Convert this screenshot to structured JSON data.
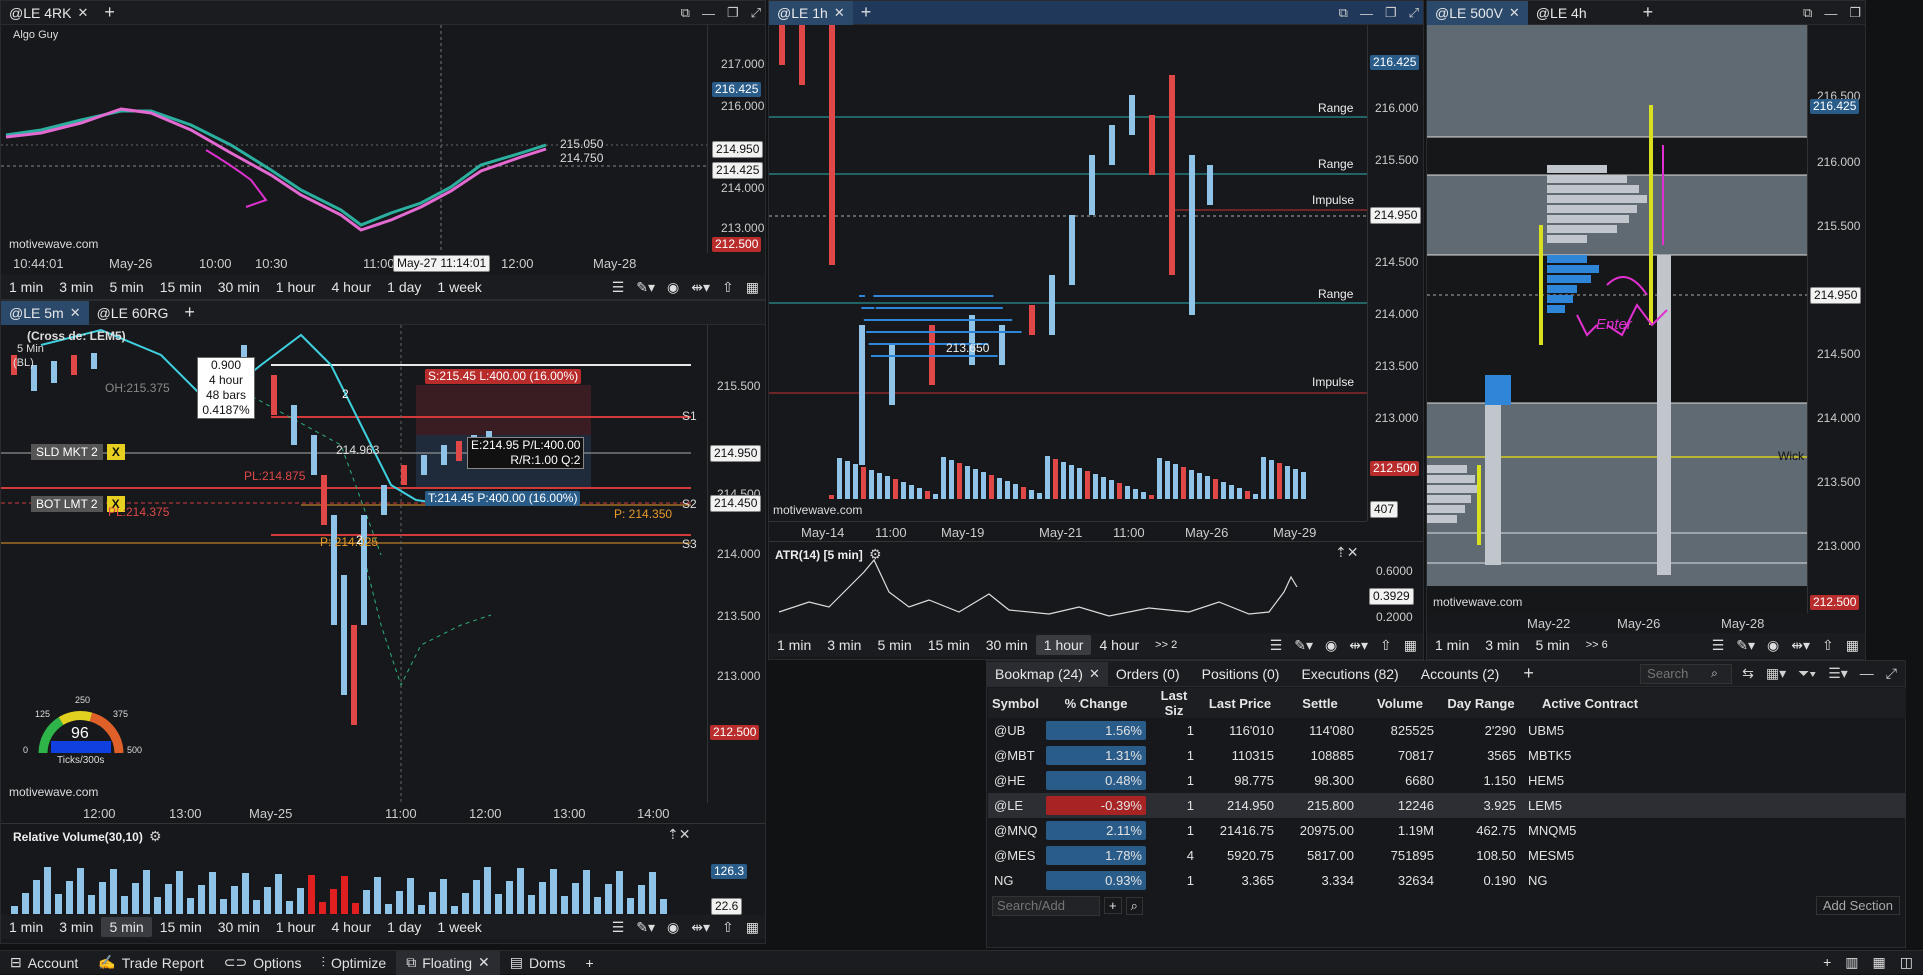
{
  "panel1": {
    "tabs": [
      "@LE 4RK"
    ],
    "subtitle": "Algo Guy",
    "watermark": "motivewave.com",
    "price_labels": [
      "217.000",
      "216.425",
      "216.000",
      "215.050",
      "214.950",
      "214.750",
      "214.425",
      "214.000",
      "213.000",
      "212.500"
    ],
    "time_labels": [
      "10:44:01",
      "May-26",
      "10:00",
      "10:30",
      "11:00",
      "May-27 11:14:01",
      "12:00",
      "May-28"
    ],
    "timeframes": [
      "1 min",
      "3 min",
      "5 min",
      "15 min",
      "30 min",
      "1 hour",
      "4 hour",
      "1 day",
      "1 week"
    ]
  },
  "panel2": {
    "tabs": [
      "@LE 5m",
      "@LE 60RG"
    ],
    "study_label": "(Cross de: LEM5)",
    "legend_lines": [
      "5 Min",
      "(BL)",
      "OH:215.375"
    ],
    "tooltip": [
      "0.900",
      "4 hour",
      "48 bars",
      "0.4187%"
    ],
    "orders": {
      "sld": "SLD MKT 2",
      "bot": "BOT LMT 2",
      "x": "X"
    },
    "trade_labels": {
      "stop": "S:215.45 L:400.00 (16.00%)",
      "entry": "E:214.95 P/L:400.00",
      "rr": "R/R:1.00 Q:2",
      "target": "T:214.45 P:400.00 (16.00%)"
    },
    "level_labels": {
      "pl1": "PL:214.875",
      "pl2": "PL:214.375",
      "p1": "P: 214.350",
      "p2": "P: 214.025",
      "v": "214.963",
      "s1": "S1",
      "s2": "S2",
      "s3": "S3",
      "two_a": "2",
      "two_b": "2"
    },
    "price_labels": [
      "215.500",
      "214.950",
      "214.500",
      "214.450",
      "214.000",
      "213.500",
      "213.000",
      "212.500"
    ],
    "time_labels": [
      "12:00",
      "13:00",
      "May-25",
      "11:00",
      "12:00",
      "13:00",
      "14:00"
    ],
    "gauge": {
      "value": "96",
      "unit": "Ticks/300s",
      "ticks": [
        "0",
        "125",
        "250",
        "375",
        "500"
      ]
    },
    "watermark": "motivewave.com",
    "rel_volume": {
      "title": "Relative Volume(30,10)",
      "labels": [
        "126.3",
        "22.6"
      ]
    },
    "timeframes": [
      "1 min",
      "3 min",
      "5 min",
      "15 min",
      "30 min",
      "1 hour",
      "4 hour",
      "1 day",
      "1 week"
    ],
    "selected_tf": "5 min"
  },
  "panel3": {
    "tabs": [
      "@LE 1h"
    ],
    "labels": [
      "Range",
      "Range",
      "Impulse",
      "Range",
      "Impulse"
    ],
    "price_labels": [
      "216.425",
      "216.000",
      "215.500",
      "214.950",
      "214.500",
      "214.000",
      "213.500",
      "213.000",
      "212.500"
    ],
    "volume_label": "407",
    "poc_label": "213.650",
    "time_labels": [
      "May-14",
      "11:00",
      "May-19",
      "May-21",
      "11:00",
      "May-26",
      "May-29"
    ],
    "watermark": "motivewave.com",
    "atr": {
      "title": "ATR(14) [5 min]",
      "labels": [
        "0.6000",
        "0.3929",
        "0.2000"
      ]
    },
    "timeframes": [
      "1 min",
      "3 min",
      "5 min",
      "15 min",
      "30 min",
      "1 hour",
      "4 hour",
      ">> 2"
    ],
    "selected_tf": "1 hour"
  },
  "panel4": {
    "tabs": [
      "@LE 500V",
      "@LE 4h"
    ],
    "price_labels": [
      "216.500",
      "216.425",
      "216.000",
      "215.500",
      "214.950",
      "214.500",
      "214.000",
      "213.500",
      "213.000",
      "212.500"
    ],
    "wick_label": "Wick",
    "annotation": "Enter",
    "watermark": "motivewave.com",
    "time_labels": [
      "May-22",
      "May-26",
      "May-28"
    ],
    "timeframes": [
      "1 min",
      "3 min",
      "5 min",
      ">> 6"
    ]
  },
  "bookmap": {
    "tabs": [
      "Bookmap (24)",
      "Orders (0)",
      "Positions (0)",
      "Executions (82)",
      "Accounts (2)"
    ],
    "search_placeholder": "Search",
    "columns": [
      "Symbol",
      "% Change",
      "Last Siz",
      "Last Price",
      "Settle",
      "Volume",
      "Day Range",
      "Active Contract"
    ],
    "rows": [
      {
        "symbol": "@UB",
        "change": "1.56%",
        "change_val": 1.56,
        "size": "1",
        "last": "116'010",
        "settle": "114'080",
        "volume": "825525",
        "range": "2'290",
        "contract": "UBM5"
      },
      {
        "symbol": "@MBT",
        "change": "1.31%",
        "change_val": 1.31,
        "size": "1",
        "last": "110315",
        "settle": "108885",
        "volume": "70817",
        "range": "3565",
        "contract": "MBTK5"
      },
      {
        "symbol": "@HE",
        "change": "0.48%",
        "change_val": 0.48,
        "size": "1",
        "last": "98.775",
        "settle": "98.300",
        "volume": "6680",
        "range": "1.150",
        "contract": "HEM5"
      },
      {
        "symbol": "@LE",
        "change": "-0.39%",
        "change_val": -0.39,
        "size": "1",
        "last": "214.950",
        "settle": "215.800",
        "volume": "12246",
        "range": "3.925",
        "contract": "LEM5"
      },
      {
        "symbol": "@MNQ",
        "change": "2.11%",
        "change_val": 2.11,
        "size": "1",
        "last": "21416.75",
        "settle": "20975.00",
        "volume": "1.19M",
        "range": "462.75",
        "contract": "MNQM5"
      },
      {
        "symbol": "@MES",
        "change": "1.78%",
        "change_val": 1.78,
        "size": "4",
        "last": "5920.75",
        "settle": "5817.00",
        "volume": "751895",
        "range": "108.50",
        "contract": "MESM5"
      },
      {
        "symbol": "NG",
        "change": "0.93%",
        "change_val": 0.93,
        "size": "1",
        "last": "3.365",
        "settle": "3.334",
        "volume": "32634",
        "range": "0.190",
        "contract": "NG"
      }
    ],
    "search_add_placeholder": "Search/Add",
    "add_section": "Add Section"
  },
  "bottom_tabs": [
    "Account",
    "Trade Report",
    "Options",
    "Optimize",
    "Floating",
    "Doms"
  ],
  "colors": {
    "up": "#8fc4e8",
    "down": "#e04848",
    "accent": "#2a5c8a"
  }
}
